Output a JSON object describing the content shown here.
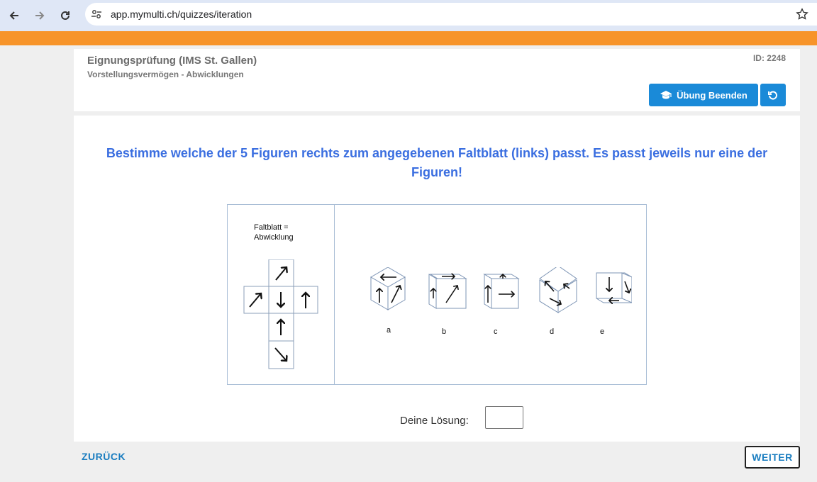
{
  "browser": {
    "url": "app.mymulti.ch/quizzes/iteration"
  },
  "header": {
    "title": "Eignungsprüfung (IMS St. Gallen)",
    "subtitle": "Vorstellungsvermögen - Abwicklungen",
    "id_label": "ID: 2248",
    "end_button": "Übung Beenden"
  },
  "question": {
    "text": "Bestimme welche der 5 Figuren rechts zum angegebenen Faltblatt (links) passt. Es passt jeweils nur eine der Figuren!",
    "faltblatt_line1": "Faltblatt =",
    "faltblatt_line2": "Abwicklung",
    "options": [
      "a",
      "b",
      "c",
      "d",
      "e"
    ]
  },
  "answer": {
    "label": "Deine Lösung:",
    "value": ""
  },
  "footer": {
    "back": "ZURÜCK",
    "next": "WEITER"
  },
  "colors": {
    "accent": "#1a8ad8",
    "orange_bar": "#f7942a",
    "question": "#3a6ee0"
  }
}
